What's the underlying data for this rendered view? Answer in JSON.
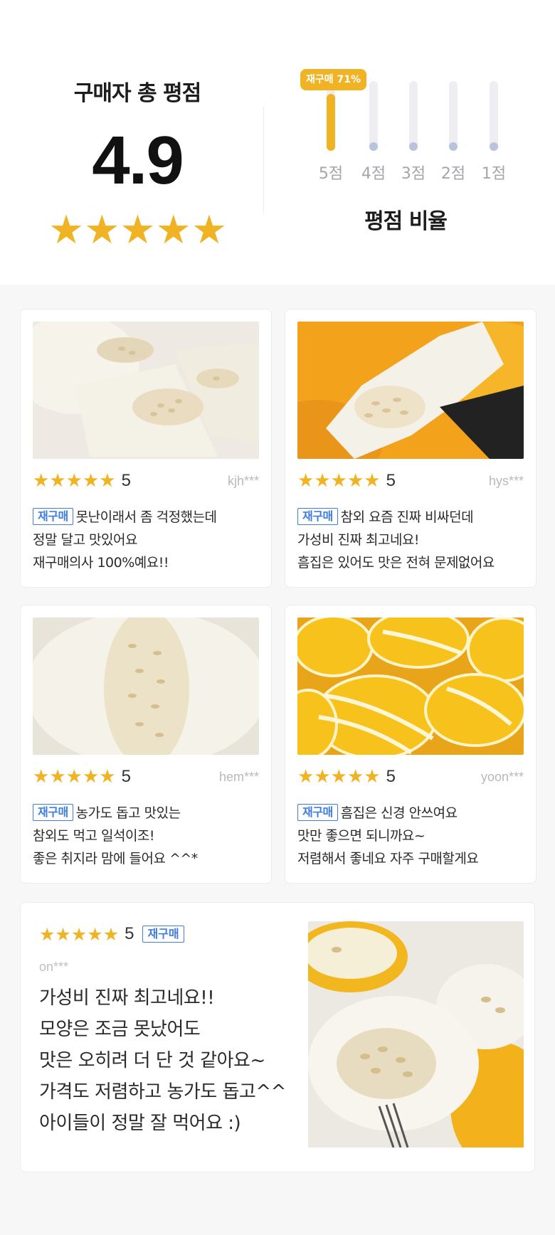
{
  "summary": {
    "title": "구매자 총 평점",
    "score": "4.9",
    "stars": 5
  },
  "ratio": {
    "title": "평점 비율",
    "badge": "재구매 71%",
    "bars": [
      {
        "label": "5점",
        "percent": 71
      },
      {
        "label": "4점",
        "percent": 0
      },
      {
        "label": "3점",
        "percent": 0
      },
      {
        "label": "2점",
        "percent": 0
      },
      {
        "label": "1점",
        "percent": 0
      }
    ]
  },
  "colors": {
    "star": "#f0b323",
    "tag": "#3f7de0",
    "bar_active": "#f0b323",
    "bar_dot": "#b9c3dc"
  },
  "icons": {
    "star": "star-icon"
  },
  "reviews": [
    {
      "rating": "5",
      "user": "kjh***",
      "tag": "재구매",
      "line1": "못난이래서 좀 걱정했는데",
      "line2": "정말 달고 맛있어요",
      "line3": "재구매의사 100%예요!!"
    },
    {
      "rating": "5",
      "user": "hys***",
      "tag": "재구매",
      "line1": "참외 요즘 진짜 비싸던데",
      "line2": "가성비 진짜 최고네요!",
      "line3": "흠집은 있어도 맛은 전혀 문제없어요"
    },
    {
      "rating": "5",
      "user": "hem***",
      "tag": "재구매",
      "line1": "농가도 돕고 맛있는",
      "line2": "참외도 먹고 일석이조!",
      "line3": "좋은 취지라 맘에 들어요 ^^*"
    },
    {
      "rating": "5",
      "user": "yoon***",
      "tag": "재구매",
      "line1": "흠집은 신경 안쓰여요",
      "line2": "맛만 좋으면 되니까요~",
      "line3": "저렴해서 좋네요 자주 구매할게요"
    }
  ],
  "featured_review": {
    "rating": "5",
    "tag": "재구매",
    "user": "on***",
    "lines": [
      "가성비 진짜 최고네요!!",
      "모양은 조금 못났어도",
      "맛은 오히려 더 단 것 같아요~",
      "가격도 저렴하고 농가도 돕고^^",
      "아이들이 정말 잘 먹어요 :)"
    ]
  }
}
